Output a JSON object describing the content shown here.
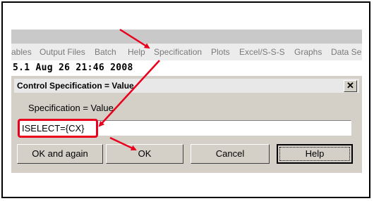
{
  "menu_items": [
    {
      "label": "ables"
    },
    {
      "label": "Output Files"
    },
    {
      "label": "Batch"
    },
    {
      "label": "Help"
    },
    {
      "label": "Specification"
    },
    {
      "label": "Plots"
    },
    {
      "label": "Excel/S-S-S"
    },
    {
      "label": "Graphs"
    },
    {
      "label": "Data Se"
    }
  ],
  "status_line": "5.1   Aug 26 21:46 2008",
  "dialog": {
    "title": "Control Specification = Value",
    "close_glyph": "✕",
    "label": "Specification = Value",
    "input_value": "ISELECT={CX}",
    "buttons": {
      "ok_again": "OK and again",
      "ok": "OK",
      "cancel": "Cancel",
      "help": "Help"
    }
  },
  "colors": {
    "annotation": "#e8001c",
    "dialog_face": "#d4d0c8"
  }
}
